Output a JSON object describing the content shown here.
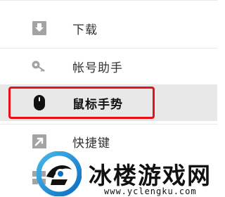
{
  "menu": {
    "items": [
      {
        "label": "下载",
        "icon": "download-icon"
      },
      {
        "label": "帐号助手",
        "icon": "key-icon"
      },
      {
        "label": "鼠标手势",
        "icon": "mouse-icon",
        "selected": true
      },
      {
        "label": "快捷键",
        "icon": "shortcut-arrow-icon"
      },
      {
        "icon": "grid-icon"
      }
    ]
  },
  "colors": {
    "highlight": "#e8101a",
    "selected_bg": "#e8e8e8",
    "icon": "#9a9a9a",
    "icon_selected": "#111111"
  },
  "watermark": {
    "title": "冰楼游戏网",
    "url": "www.yclengku.com"
  }
}
